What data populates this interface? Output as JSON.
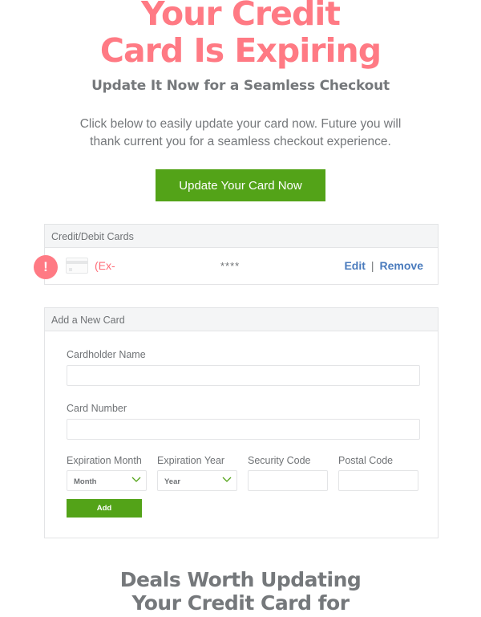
{
  "hero": {
    "title_line1": "Your Credit",
    "title_line2": "Card Is Expiring",
    "subtitle": "Update It Now for a Seamless Checkout",
    "intro_line1": "Click below to easily update your card now. Future you will",
    "intro_line2": "thank current you for a seamless checkout experience.",
    "cta_label": "Update Your Card Now"
  },
  "colors": {
    "accent_pink": "#ff7a84",
    "accent_green": "#53a318",
    "link_blue": "#4a7bbd",
    "text_gray": "#75787b"
  },
  "cards_panel": {
    "title": "Credit/Debit Cards",
    "cards": [
      {
        "alert_icon": "exclamation-alert-icon",
        "card_icon": "credit-card-icon",
        "expiry_text": "(Ex-",
        "masked_number": "****",
        "edit_label": "Edit",
        "separator": "|",
        "remove_label": "Remove"
      }
    ]
  },
  "add_card": {
    "title": "Add a New Card",
    "cardholder_label": "Cardholder Name",
    "cardholder_value": "",
    "card_number_label": "Card Number",
    "card_number_value": "",
    "exp_month_label": "Expiration Month",
    "exp_month_selected": "Month",
    "exp_year_label": "Expiration Year",
    "exp_year_selected": "Year",
    "security_code_label": "Security Code",
    "security_code_value": "",
    "postal_code_label": "Postal Code",
    "postal_code_value": "",
    "add_label": "Add"
  },
  "deals": {
    "title_line1": "Deals Worth Updating",
    "title_line2": "Your Credit Card for"
  }
}
